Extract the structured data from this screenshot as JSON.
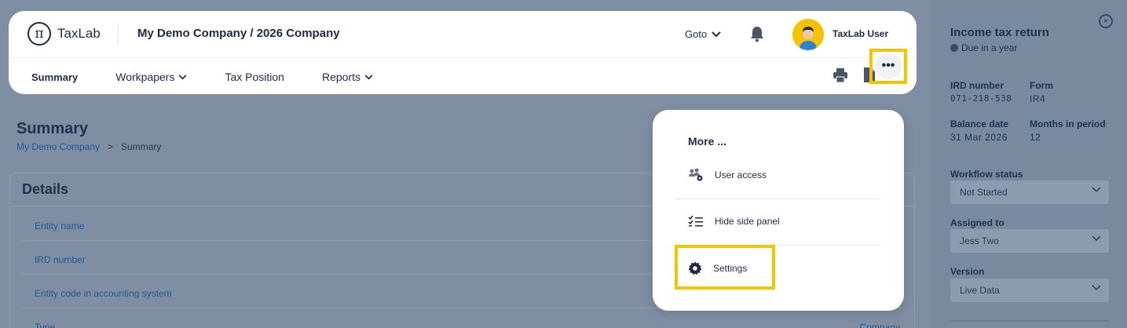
{
  "header": {
    "logo_text": "TaxLab",
    "company_title": "My Demo Company / 2026 Company",
    "goto_label": "Goto",
    "user_name": "TaxLab User",
    "icons": [
      "logo-pi-icon",
      "chevron-down-icon",
      "bell-icon",
      "avatar",
      "print-icon",
      "file-icon",
      "more-icon"
    ]
  },
  "nav": {
    "items": [
      {
        "label": "Summary",
        "active": true,
        "dropdown": false
      },
      {
        "label": "Workpapers",
        "active": false,
        "dropdown": true
      },
      {
        "label": "Tax Position",
        "active": false,
        "dropdown": false
      },
      {
        "label": "Reports",
        "active": false,
        "dropdown": true
      }
    ],
    "more_label": "•••"
  },
  "page": {
    "title": "Summary",
    "breadcrumb": {
      "link": "My Demo Company",
      "separator": ">",
      "current": "Summary"
    },
    "details": {
      "title": "Details",
      "rows": [
        {
          "label": "Entity name",
          "value": ""
        },
        {
          "label": "IRD number",
          "value": ""
        },
        {
          "label": "Entity code in accounting system",
          "value": ""
        },
        {
          "label": "Type",
          "value": "Company"
        }
      ]
    }
  },
  "side_panel": {
    "title": "Income tax return",
    "due": "Due in a year",
    "ird_label": "IRD number",
    "ird_value": "071-218-538",
    "form_label": "Form",
    "form_value": "IR4",
    "balance_label": "Balance date",
    "balance_value": "31 Mar 2026",
    "months_label": "Months in period",
    "months_value": "12",
    "workflow_label": "Workflow status",
    "workflow_value": "Not Started",
    "assigned_label": "Assigned to",
    "assigned_value": "Jess Two",
    "version_label": "Version",
    "version_value": "Live Data",
    "close_label": "×"
  },
  "menu": {
    "title": "More ...",
    "items": [
      {
        "label": "User access",
        "icon": "users-gear-icon"
      },
      {
        "label": "Hide side panel",
        "icon": "checklist-icon"
      },
      {
        "label": "Settings",
        "icon": "gear-icon"
      }
    ]
  },
  "colors": {
    "highlight": "#f5c400",
    "overlay": "#7f8ea3",
    "navy": "#1e2a44",
    "link": "#1f5a96"
  }
}
